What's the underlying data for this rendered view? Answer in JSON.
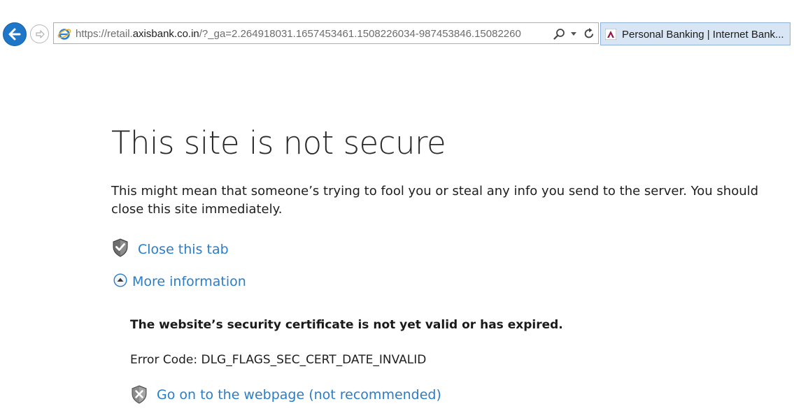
{
  "browser": {
    "address_bar": {
      "url_prefix": "https://retail.",
      "url_domain": "axisbank.co.in",
      "url_rest": "/?_ga=2.264918031.1657453461.1508226034-987453846.15082260"
    },
    "tab": {
      "title": "Personal Banking | Internet Bank..."
    },
    "icons": {
      "back": "back-arrow-icon",
      "forward": "forward-arrow-icon",
      "site": "ie-logo-icon",
      "search": "search-icon",
      "dropdown": "chevron-down-icon",
      "refresh": "refresh-icon",
      "favicon": "axis-bank-favicon"
    },
    "colors": {
      "back_button": "#1e76c9",
      "tab_background": "#d7e5f4"
    }
  },
  "error_page": {
    "title": "This site is not secure",
    "description": "This might mean that someone’s trying to fool you or steal any info you send to the server. You should close this site immediately.",
    "close_tab_label": "Close this tab",
    "more_info_label": "More information",
    "detail_heading": "The website’s security certificate is not yet valid or has expired.",
    "error_code": "Error Code: DLG_FLAGS_SEC_CERT_DATE_INVALID",
    "go_on_label": "Go on to the webpage (not recommended)",
    "icons": {
      "close_tab": "shield-check-icon",
      "more_info": "collapse-circle-icon",
      "go_on": "shield-x-icon"
    },
    "colors": {
      "link": "#2a7dc8",
      "title": "#2a2a2a"
    }
  }
}
